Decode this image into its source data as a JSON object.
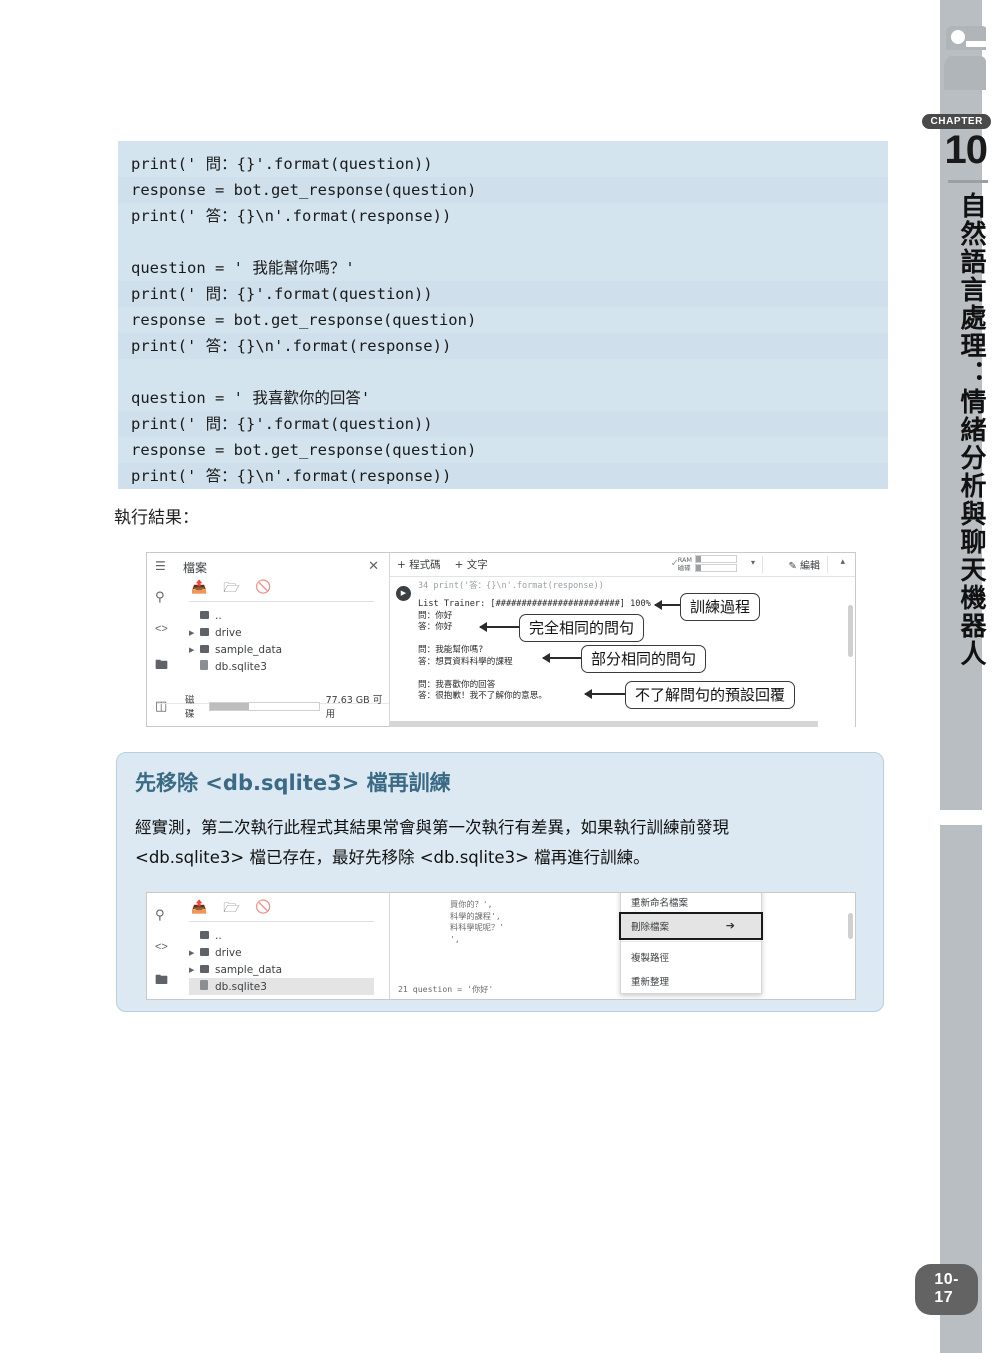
{
  "chapter": {
    "badge": "CHAPTER",
    "number": "10",
    "title": "自然語言處理：情緒分析與聊天機器人",
    "page_number": "10-17"
  },
  "code_block": {
    "lines": [
      "print(' 問：{}'.format(question))",
      "response = bot.get_response(question)",
      "print(' 答：{}\\n'.format(response))",
      "",
      "question = ' 我能幫你嗎？'",
      "print(' 問：{}'.format(question))",
      "response = bot.get_response(question)",
      "print(' 答：{}\\n'.format(response))",
      "",
      "question = ' 我喜歡你的回答'",
      "print(' 問：{}'.format(question))",
      "response = bot.get_response(question)",
      "print(' 答：{}\\n'.format(response))"
    ]
  },
  "result_label": "執行結果：",
  "screenshot1": {
    "file_panel": {
      "menu_icon": "hamburger-icon",
      "title": "檔案",
      "close": "✕",
      "rail_icons": [
        "search-icon",
        "code-icon",
        "folder-icon",
        "notes-icon"
      ],
      "tool_icons": [
        "upload-file-icon",
        "mount-drive-icon",
        "refresh-disabled-icon"
      ],
      "tree": [
        {
          "name": "..",
          "type": "up"
        },
        {
          "name": "drive",
          "type": "folder"
        },
        {
          "name": "sample_data",
          "type": "folder"
        },
        {
          "name": "db.sqlite3",
          "type": "file"
        }
      ],
      "disk_label": "磁碟",
      "disk_free": "77.63 GB 可用"
    },
    "toolbar": {
      "add_code": "+ 程式碼",
      "add_text": "+ 文字",
      "ram_label": "RAM",
      "disk_label": "磁碟",
      "edit_label": "編輯"
    },
    "cell": {
      "code_line": "34 print('答：{}\\n'.format(response))",
      "output": "List Trainer: [########################] 100%\n問：你好\n答：你好\n\n問：我能幫你嗎?\n答：想買資料科學的課程\n\n問：我喜歡你的回答\n答：很抱歉！我不了解你的意思。"
    },
    "callouts": [
      {
        "text": "訓練過程"
      },
      {
        "text": "完全相同的問句"
      },
      {
        "text": "部分相同的問句"
      },
      {
        "text": "不了解問句的預設回覆"
      }
    ]
  },
  "tip_box": {
    "heading": "先移除 <db.sqlite3> 檔再訓練",
    "paragraph_line1": "經實測，第二次執行此程式其結果常會與第一次執行有差異，如果執行訓練前發現",
    "paragraph_line2": "<db.sqlite3> 檔已存在，最好先移除 <db.sqlite3> 檔再進行訓練。"
  },
  "screenshot2": {
    "file_panel": {
      "rail_icons": [
        "search-icon",
        "code-icon",
        "folder-icon"
      ],
      "tool_icons": [
        "upload-file-icon",
        "mount-drive-icon",
        "refresh-disabled-icon"
      ],
      "tree": [
        {
          "name": "..",
          "type": "up"
        },
        {
          "name": "drive",
          "type": "folder"
        },
        {
          "name": "sample_data",
          "type": "folder"
        },
        {
          "name": "db.sqlite3",
          "type": "file",
          "selected": true
        }
      ]
    },
    "context_menu": {
      "items": [
        "重新命名檔案",
        "刪除檔案",
        "複製路徑",
        "重新整理"
      ],
      "highlighted": "刪除檔案"
    },
    "code_fragment": "買你的？',\n科學的課程',\n料科學呢呢？'\n',",
    "code_fragment2": "21 question = '你好'"
  },
  "colors": {
    "code_bg": "#d4e4ef",
    "tip_bg": "#dce9f2",
    "tip_heading": "#3b6a86",
    "side_grey": "#b9bec2",
    "page_badge": "#636363"
  }
}
